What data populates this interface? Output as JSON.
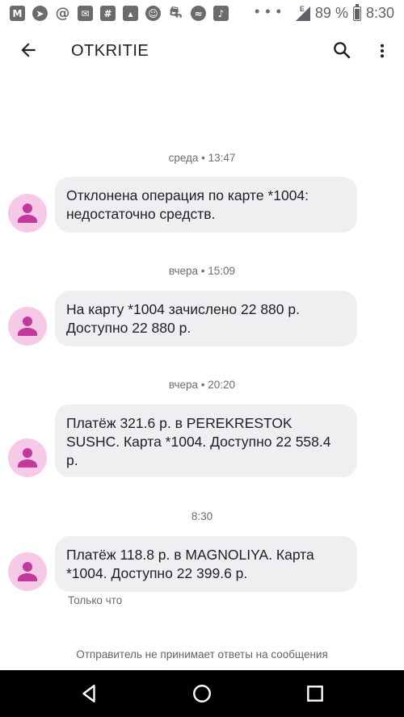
{
  "status_bar": {
    "icons": [
      "gmail-icon",
      "telegram-icon",
      "at-icon",
      "mail-icon",
      "slack-icon",
      "image-icon",
      "android-icon",
      "car-icon",
      "waves-icon",
      "music-icon"
    ],
    "battery": "89 %",
    "time": "8:30",
    "network": "E"
  },
  "app_bar": {
    "title": "OTKRITIE"
  },
  "messages": [
    {
      "timestamp": "среда • 13:47",
      "text": "Отклонена операция по карте *1004: недостаточно средств."
    },
    {
      "timestamp": "вчера • 15:09",
      "text": "На карту *1004 зачислено 22 880 р. Доступно 22 880 р."
    },
    {
      "timestamp": "вчера • 20:20",
      "text": "Платёж 321.6 р. в PEREKRESTOK SUSHC. Карта *1004. Доступно 22 558.4 р."
    },
    {
      "timestamp": "8:30",
      "text": "Платёж 118.8 р. в MAGNOLIYA. Карта *1004. Доступно 22 399.6 р.",
      "status": "Только что"
    }
  ],
  "footer": "Отправитель не принимает ответы на сообщения",
  "colors": {
    "avatar_bg": "#f6c9e6",
    "avatar_fg": "#c2399b",
    "bubble_bg": "#eeeff1",
    "navbar_bg": "#000000"
  }
}
